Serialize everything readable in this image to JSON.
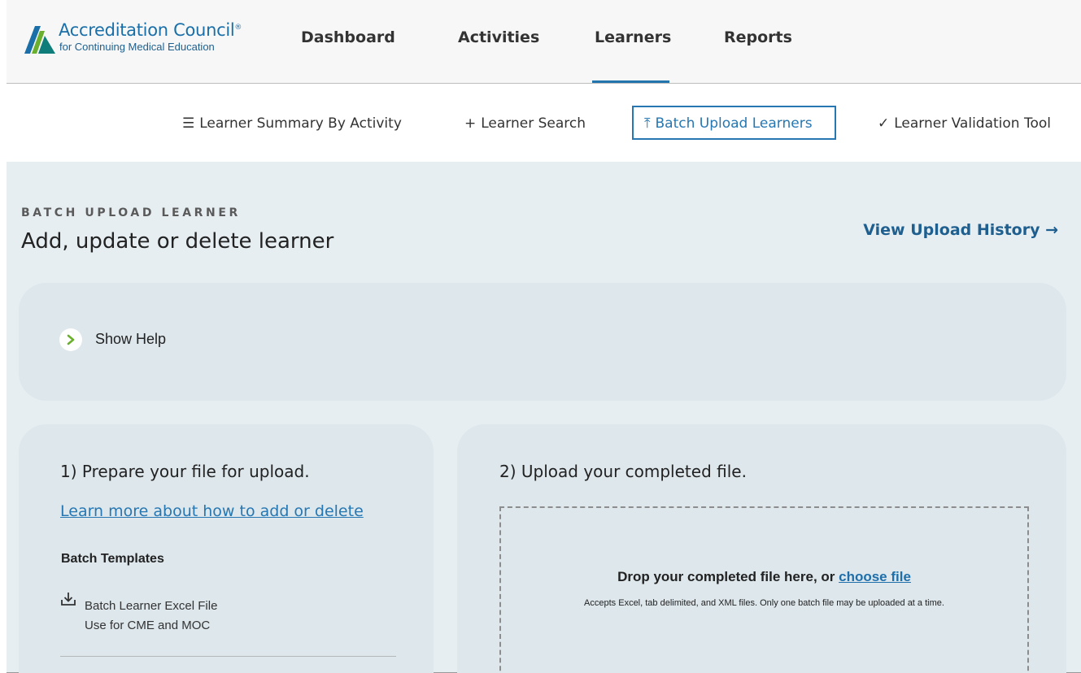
{
  "brand": {
    "name": "Accreditation Council",
    "tagline": "for Continuing Medical Education",
    "colors": {
      "blue": "#1a6fa8",
      "green": "#6aaf2e",
      "teal": "#0f7d7a"
    }
  },
  "nav": {
    "items": [
      {
        "label": "Dashboard"
      },
      {
        "label": "Activities"
      },
      {
        "label": "Learners",
        "active": true
      },
      {
        "label": "Reports"
      }
    ]
  },
  "subnav": {
    "items": [
      {
        "icon": "list-icon",
        "glyph": "☰",
        "label": "Learner Summary By Activity"
      },
      {
        "icon": "plus-icon",
        "glyph": "+",
        "label": "Learner Search"
      },
      {
        "icon": "upload-icon",
        "glyph": "⤒",
        "label": "Batch Upload Learners",
        "active": true
      },
      {
        "icon": "check-icon",
        "glyph": "✓",
        "label": "Learner Validation Tool"
      }
    ]
  },
  "page": {
    "eyebrow": "BATCH UPLOAD LEARNER",
    "title": "Add, update or delete learner",
    "history_link": "View Upload History →"
  },
  "help": {
    "label": "Show Help"
  },
  "prepare": {
    "heading": "1) Prepare your file for upload.",
    "learn_link": "Learn more about how to add or delete",
    "templates_title": "Batch Templates",
    "templates": [
      {
        "icon": "download-icon",
        "name": "Batch Learner Excel File",
        "description": "Use for CME and MOC"
      }
    ]
  },
  "upload": {
    "heading": "2) Upload your completed file.",
    "drop_text": "Drop your completed file here, or",
    "choose_link": "choose file",
    "accepts_note": "Accepts Excel, tab delimited, and XML files. Only one batch file may be uploaded at a time."
  }
}
